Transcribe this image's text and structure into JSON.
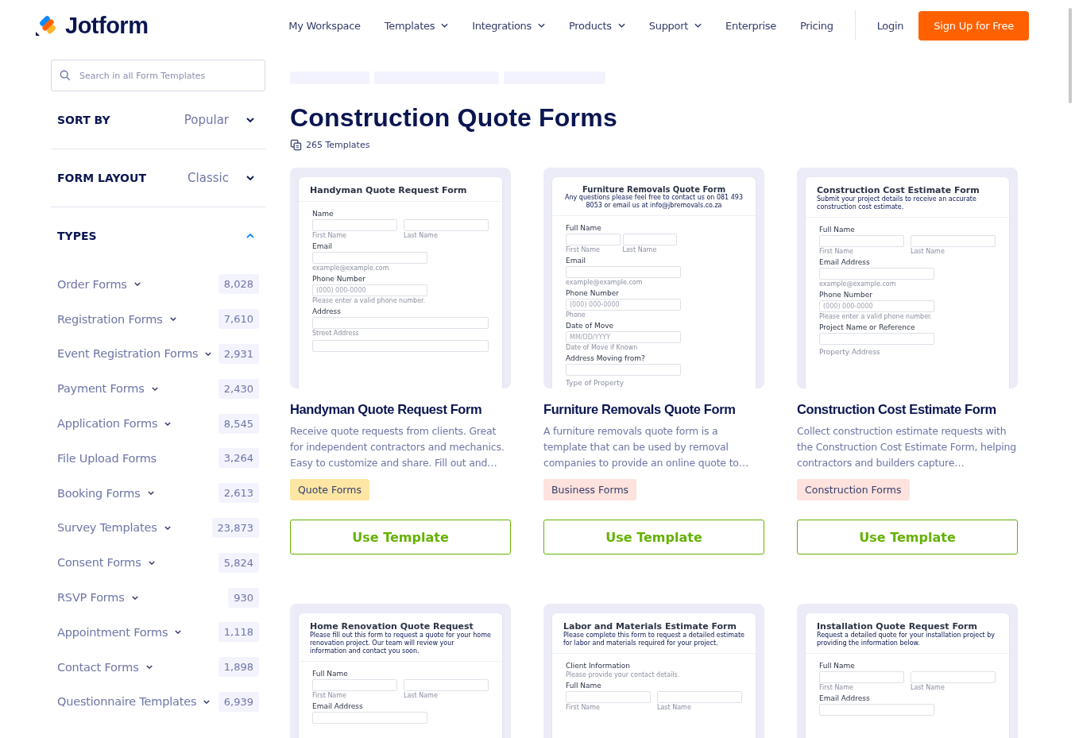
{
  "header": {
    "logo": "Jotform",
    "nav": [
      {
        "label": "My Workspace",
        "dropdown": false
      },
      {
        "label": "Templates",
        "dropdown": true
      },
      {
        "label": "Integrations",
        "dropdown": true
      },
      {
        "label": "Products",
        "dropdown": true
      },
      {
        "label": "Support",
        "dropdown": true
      },
      {
        "label": "Enterprise",
        "dropdown": false
      },
      {
        "label": "Pricing",
        "dropdown": false
      }
    ],
    "login": "Login",
    "signup": "Sign Up for Free"
  },
  "sidebar": {
    "search": {
      "placeholder": "Search in all Form Templates"
    },
    "filters": [
      {
        "label": "SORT BY",
        "value": "Popular"
      },
      {
        "label": "FORM LAYOUT",
        "value": "Classic"
      }
    ],
    "types": {
      "label": "TYPES",
      "expanded": true,
      "items": [
        {
          "name": "Order Forms",
          "dropdown": true,
          "count": "8,028"
        },
        {
          "name": "Registration Forms",
          "dropdown": true,
          "count": "7,610"
        },
        {
          "name": "Event Registration Forms",
          "dropdown": true,
          "count": "2,931"
        },
        {
          "name": "Payment Forms",
          "dropdown": true,
          "count": "2,430"
        },
        {
          "name": "Application Forms",
          "dropdown": true,
          "count": "8,545"
        },
        {
          "name": "File Upload Forms",
          "dropdown": false,
          "count": "3,264"
        },
        {
          "name": "Booking Forms",
          "dropdown": true,
          "count": "2,613"
        },
        {
          "name": "Survey Templates",
          "dropdown": true,
          "count": "23,873"
        },
        {
          "name": "Consent Forms",
          "dropdown": true,
          "count": "5,824"
        },
        {
          "name": "RSVP Forms",
          "dropdown": true,
          "count": "930"
        },
        {
          "name": "Appointment Forms",
          "dropdown": true,
          "count": "1,118"
        },
        {
          "name": "Contact Forms",
          "dropdown": true,
          "count": "1,898"
        },
        {
          "name": "Questionnaire Templates",
          "dropdown": true,
          "count": "6,939"
        }
      ]
    }
  },
  "main": {
    "title": "Construction Quote Forms",
    "count": "265 Templates",
    "cards": [
      {
        "preview": {
          "title": "Handyman Quote Request Form",
          "centered": false,
          "fields": [
            {
              "kind": "pair",
              "label": "Name",
              "hints": [
                "First Name",
                "Last Name"
              ]
            },
            {
              "kind": "single",
              "label": "Email",
              "hints": [
                "example@example.com"
              ]
            },
            {
              "kind": "single",
              "label": "Phone Number",
              "placeholder": "(000) 000-0000",
              "hints": [
                "Please enter a valid phone number."
              ]
            },
            {
              "kind": "wide",
              "label": "Address",
              "hints": [
                "Street Address"
              ]
            },
            {
              "kind": "wide"
            }
          ]
        },
        "name": "Handyman Quote Request Form",
        "description": "Receive quote requests from clients. Great for independent contractors and mechanics. Easy to customize and share. Fill out and…",
        "tag": "Quote Forms",
        "color": "#fde6a4",
        "button": "Use Template"
      },
      {
        "preview": {
          "title": "Furniture Removals Quote Form",
          "subtitle": "Any questions please feel free to contact us on 081 493 8053 or email us at info@jbremovals.co.za",
          "centered": true,
          "fields": [
            {
              "kind": "short-pair",
              "label": "Full Name",
              "hints": [
                "First Name",
                "Last Name"
              ]
            },
            {
              "kind": "single",
              "label": "Email",
              "hints": [
                "example@example.com"
              ]
            },
            {
              "kind": "single",
              "label": "Phone Number",
              "placeholder": "(000) 000-0000",
              "hints": [
                "Phone"
              ]
            },
            {
              "kind": "single",
              "label": "Date of Move",
              "placeholder": "MM/DD/YYYY",
              "hints": [
                "Date of Move if Known"
              ]
            },
            {
              "kind": "single",
              "label": "Address Moving from?"
            },
            {
              "kind": "label",
              "label": "Type of Property"
            }
          ]
        },
        "name": "Furniture Removals Quote Form",
        "description": "A furniture removals quote form is a template that can be used by removal companies to provide an online quote to…",
        "tag": "Business Forms",
        "color": "#fde2dd",
        "button": "Use Template"
      },
      {
        "preview": {
          "title": "Construction Cost Estimate Form",
          "subtitle": "Submit your project details to receive an accurate construction cost estimate.",
          "centered": false,
          "fields": [
            {
              "kind": "pair",
              "label": "Full Name",
              "hints": [
                "First Name",
                "Last Name"
              ]
            },
            {
              "kind": "single",
              "label": "Email Address",
              "hints": [
                "example@example.com"
              ]
            },
            {
              "kind": "single",
              "label": "Phone Number",
              "placeholder": "(000) 000-0000",
              "hints": [
                "Please enter a valid phone number."
              ]
            },
            {
              "kind": "single",
              "label": "Project Name or Reference"
            },
            {
              "kind": "label",
              "label": "Property Address"
            }
          ]
        },
        "name": "Construction Cost Estimate Form",
        "description": "Collect construction estimate requests with the Construction Cost Estimate Form, helping contractors and builders capture…",
        "tag": "Construction Forms",
        "color": "#fde2dd",
        "button": "Use Template"
      },
      {
        "preview": {
          "title": "Home Renovation Quote Request",
          "subtitle": "Please fill out this form to request a quote for your home renovation project. Our team will review your information and contact you soon.",
          "centered": false,
          "fields": [
            {
              "kind": "pair",
              "label": "Full Name",
              "hints": [
                "First Name",
                "Last Name"
              ]
            },
            {
              "kind": "single",
              "label": "Email Address"
            }
          ]
        }
      },
      {
        "preview": {
          "title": "Labor and Materials Estimate Form",
          "subtitle": "Please complete this form to request a detailed estimate for labor and materials required for your project.",
          "centered": false,
          "fields": [
            {
              "kind": "section",
              "label": "Client Information",
              "hints": [
                "Please provide your contact details."
              ]
            },
            {
              "kind": "pair",
              "label": "Full Name",
              "hints": [
                "First Name",
                "Last Name"
              ]
            }
          ]
        }
      },
      {
        "preview": {
          "title": "Installation Quote Request Form",
          "subtitle": "Request a detailed quote for your installation project by providing the information below.",
          "centered": false,
          "fields": [
            {
              "kind": "pair",
              "label": "Full Name",
              "hints": [
                "First Name",
                "Last Name"
              ]
            },
            {
              "kind": "single",
              "label": "Email Address"
            }
          ]
        }
      }
    ]
  }
}
